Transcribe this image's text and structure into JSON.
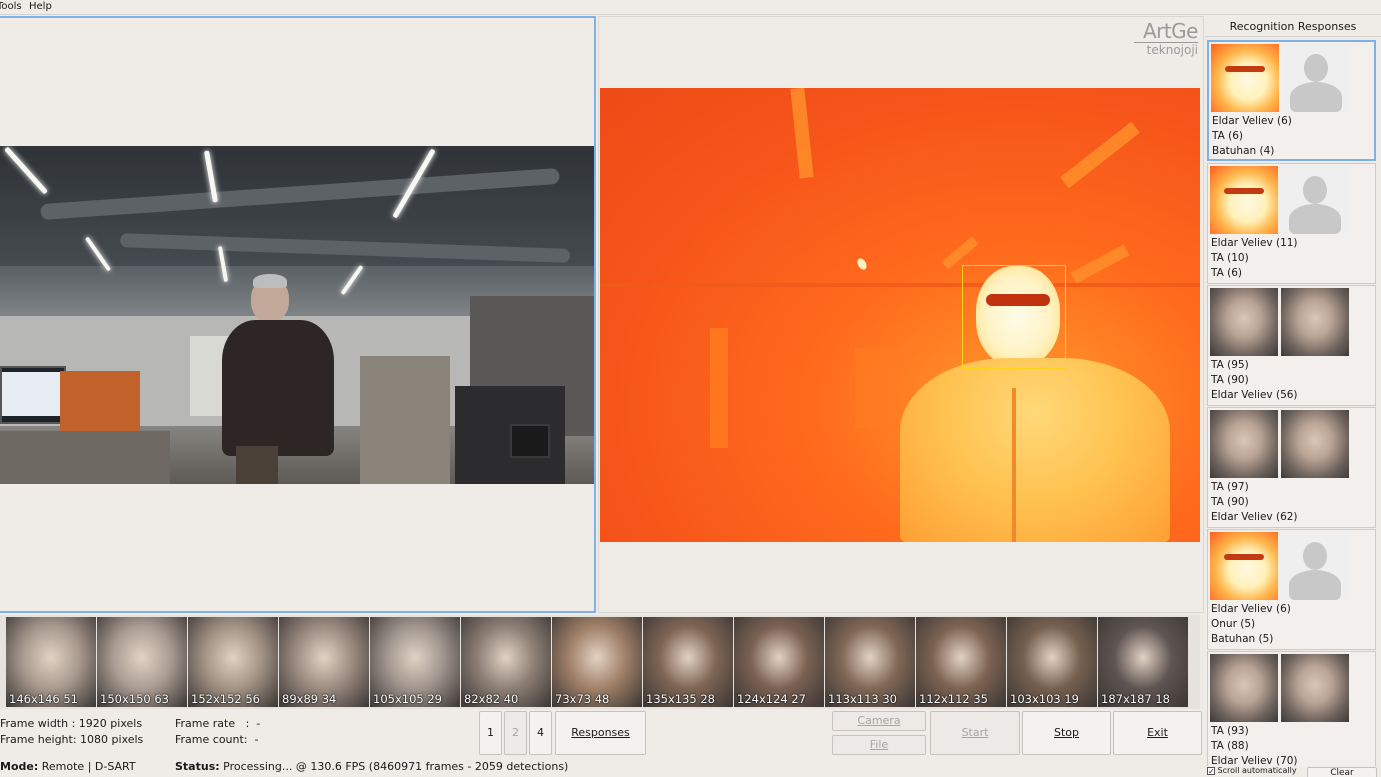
{
  "menu": {
    "tools": "Tools",
    "help": "Help"
  },
  "logo": {
    "line1": "ArtGe",
    "line2": "teknojoji"
  },
  "responses": {
    "title": "Recognition Responses",
    "cards": [
      {
        "query": "thermal",
        "match": "empty",
        "names": [
          "Eldar Veliev (6)",
          "TA (6)",
          "Batuhan (4)"
        ],
        "selected": true
      },
      {
        "query": "thermal",
        "match": "empty",
        "names": [
          "Eldar Veliev (11)",
          "TA (10)",
          "TA (6)"
        ],
        "selected": false
      },
      {
        "query": "rgb",
        "match": "rgb",
        "names": [
          "TA (95)",
          "TA (90)",
          "Eldar Veliev (56)"
        ],
        "selected": false
      },
      {
        "query": "rgb",
        "match": "rgb",
        "names": [
          "TA (97)",
          "TA (90)",
          "Eldar Veliev (62)"
        ],
        "selected": false
      },
      {
        "query": "thermal",
        "match": "empty",
        "names": [
          "Eldar Veliev (6)",
          "Onur (5)",
          "Batuhan (5)"
        ],
        "selected": false
      },
      {
        "query": "rgb",
        "match": "rgb",
        "names": [
          "TA (93)",
          "TA (88)",
          "Eldar Veliev (70)"
        ],
        "selected": false
      }
    ],
    "scroll_label": "Scroll automatically",
    "clear_label": "Clear"
  },
  "faces": [
    {
      "label": "146x146 51",
      "tone": "#a8998e"
    },
    {
      "label": "150x150 63",
      "tone": "#aa9c92"
    },
    {
      "label": "152x152 56",
      "tone": "#a39385"
    },
    {
      "label": "89x89 34",
      "tone": "#9c8b80"
    },
    {
      "label": "105x105 29",
      "tone": "#a0958d"
    },
    {
      "label": "82x82 40",
      "tone": "#8d7f75"
    },
    {
      "label": "73x73 48",
      "tone": "#a08068"
    },
    {
      "label": "135x135 28",
      "tone": "#7e6554"
    },
    {
      "label": "124x124 27",
      "tone": "#7a6152"
    },
    {
      "label": "113x113 30",
      "tone": "#806756"
    },
    {
      "label": "112x112 35",
      "tone": "#7c6352"
    },
    {
      "label": "103x103 19",
      "tone": "#76604f"
    },
    {
      "label": "187x187 18",
      "tone": "#5f5552"
    }
  ],
  "info": {
    "frame_width": "Frame width : 1920 pixels",
    "frame_height": "Frame height: 1080 pixels",
    "frame_rate": "Frame rate   :  -",
    "frame_count": "Frame count:  -"
  },
  "layout_buttons": [
    "1",
    "2",
    "4"
  ],
  "buttons": {
    "responses": "Responses",
    "camera": "Camera",
    "file": "File",
    "start": "Start",
    "stop": "Stop",
    "exit": "Exit"
  },
  "status": {
    "mode_label": "Mode:",
    "mode_value": "Remote | D-SART",
    "status_label": "Status:",
    "status_value": "Processing... @ 130.6 FPS (8460971 frames - 2059 detections)"
  }
}
